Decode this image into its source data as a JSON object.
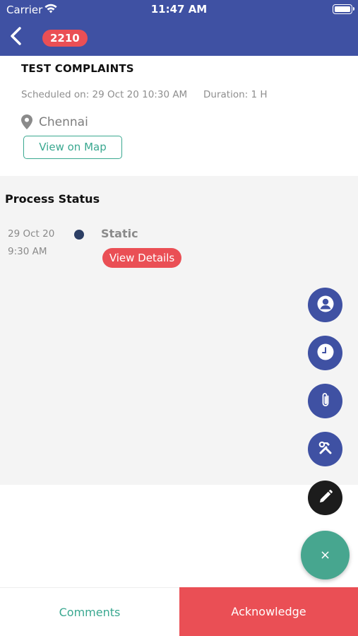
{
  "status_bar": {
    "carrier": "Carrier",
    "time": "11:47 AM"
  },
  "header": {
    "badge": "2210",
    "color": "#3f51a3"
  },
  "complaint": {
    "title": "TEST COMPLAINTS",
    "scheduled": "Scheduled on: 29 Oct 20 10:30 AM",
    "duration": "Duration: 1 H",
    "location": "Chennai",
    "map_button": "View on Map"
  },
  "process": {
    "title": "Process Status",
    "steps": [
      {
        "date": "29 Oct 20",
        "time": "9:30 AM",
        "label": "Static",
        "button": "View Details"
      }
    ]
  },
  "fabs": {
    "icons": [
      "user-icon",
      "clock-icon",
      "paperclip-icon",
      "tools-icon",
      "pencil-icon"
    ],
    "close_glyph": "×"
  },
  "bottom_bar": {
    "comments": "Comments",
    "acknowledge": "Acknowledge"
  },
  "colors": {
    "primary": "#3f51a3",
    "accent_red": "#ea4f55",
    "accent_green": "#3aa890"
  }
}
